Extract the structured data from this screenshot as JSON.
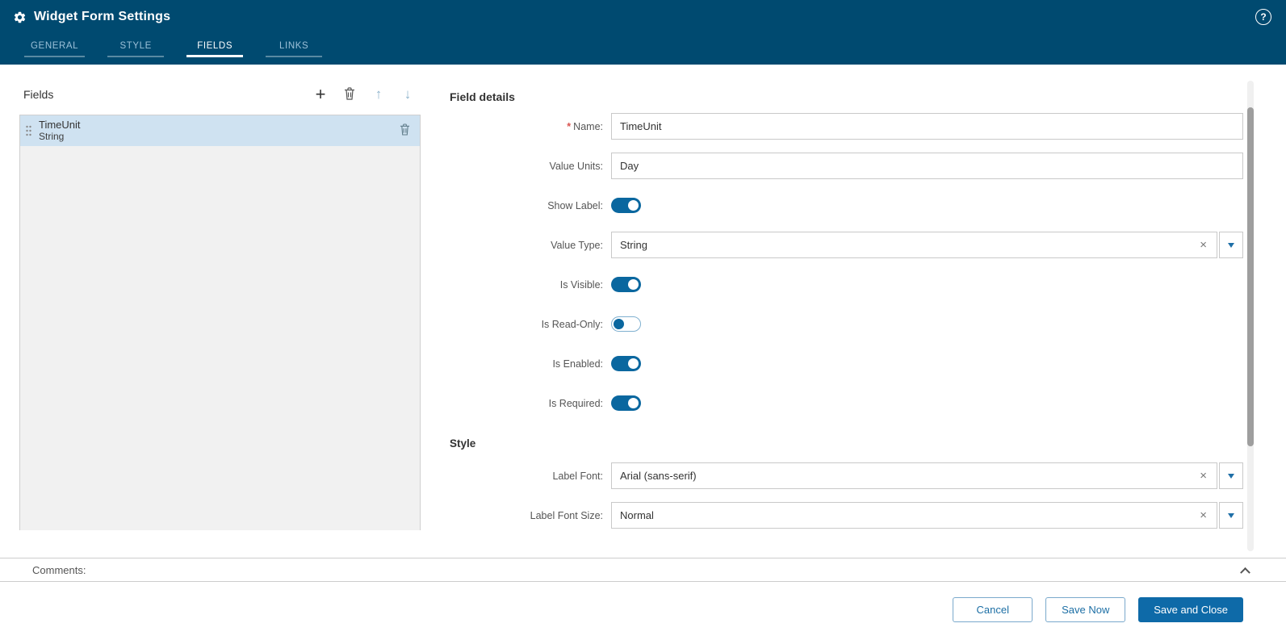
{
  "header": {
    "title": "Widget Form Settings",
    "tabs": [
      {
        "label": "GENERAL",
        "active": false
      },
      {
        "label": "STYLE",
        "active": false
      },
      {
        "label": "FIELDS",
        "active": true
      },
      {
        "label": "LINKS",
        "active": false
      }
    ]
  },
  "fields_panel": {
    "title": "Fields",
    "items": [
      {
        "name": "TimeUnit",
        "type": "String",
        "selected": true
      }
    ]
  },
  "details": {
    "title": "Field details",
    "required_marker": "*",
    "style_heading": "Style",
    "rows": {
      "name": {
        "label": "Name:",
        "value": "TimeUnit",
        "required": true
      },
      "value_units": {
        "label": "Value Units:",
        "value": "Day"
      },
      "show_label": {
        "label": "Show Label:",
        "on": true
      },
      "value_type": {
        "label": "Value Type:",
        "value": "String"
      },
      "is_visible": {
        "label": "Is Visible:",
        "on": true
      },
      "is_read_only": {
        "label": "Is Read-Only:",
        "on": false
      },
      "is_enabled": {
        "label": "Is Enabled:",
        "on": true
      },
      "is_required": {
        "label": "Is Required:",
        "on": true
      },
      "label_font": {
        "label": "Label Font:",
        "value": "Arial (sans-serif)"
      },
      "label_font_size": {
        "label": "Label Font Size:",
        "value": "Normal"
      }
    }
  },
  "comments": {
    "label": "Comments:"
  },
  "footer": {
    "cancel_label": "Cancel",
    "save_now_label": "Save Now",
    "save_and_close_label": "Save and Close"
  },
  "icons": {
    "help": "?",
    "add": "+",
    "move_up": "↑",
    "move_down": "↓",
    "clear": "×"
  },
  "colors": {
    "header_bg": "#004a70",
    "accent": "#0e6aa8",
    "toggle_on": "#0a679f",
    "selected_row": "#cfe2f1"
  }
}
